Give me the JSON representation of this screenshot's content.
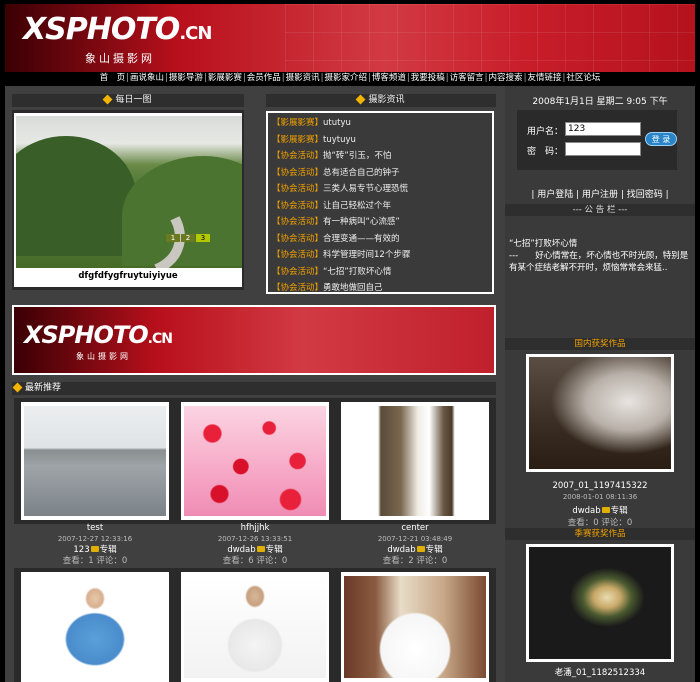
{
  "site": {
    "logo_main": "XSPHOTO",
    "logo_tld": ".CN",
    "logo_sub": "象山摄影网"
  },
  "nav": {
    "items": [
      "首　页",
      "画说象山",
      "摄影导游",
      "影展影赛",
      "会员作品",
      "摄影资讯",
      "摄影家介绍",
      "博客频道",
      "我要投稿",
      "访客留言",
      "内容搜索",
      "友情链接",
      "社区论坛"
    ]
  },
  "daily": {
    "title": "每日一图",
    "caption": "dfgfdfygfruytuiyiyue",
    "pager": [
      "1",
      "2",
      "3"
    ]
  },
  "news": {
    "title": "摄影资讯",
    "items": [
      {
        "tag": "【影展影赛】",
        "text": "ututyu"
      },
      {
        "tag": "【影展影赛】",
        "text": "tuytuyu"
      },
      {
        "tag": "【协会活动】",
        "text": "抛“砖”引玉，不怕"
      },
      {
        "tag": "【协会活动】",
        "text": "总有适合自己的钟子"
      },
      {
        "tag": "【协会活动】",
        "text": "三类人易专节心理恐慌"
      },
      {
        "tag": "【协会活动】",
        "text": "让自己轻松过个年"
      },
      {
        "tag": "【协会活动】",
        "text": "有一种病叫“心流感”"
      },
      {
        "tag": "【协会活动】",
        "text": "合理变通——有效的"
      },
      {
        "tag": "【协会活动】",
        "text": "科学管理时间12个步骤"
      },
      {
        "tag": "【协会活动】",
        "text": "“七招”打败坏心情"
      },
      {
        "tag": "【协会活动】",
        "text": "勇敢地做回自己"
      }
    ]
  },
  "login": {
    "date": "2008年1月1日 星期二 9:05 下午",
    "username_label": "用户名：",
    "username_value": "123",
    "password_label": "密　码：",
    "submit_label": "登 录",
    "links": "| 用户登陆 | 用户注册 | 找回密码 |"
  },
  "notice": {
    "title": "--- 公 告 栏 ---",
    "heading": "“七招”打败坏心情",
    "body": "---　　好心情常在，坏心情也不时光顾，特别是有某个症结老解不开时，烦恼常常会来猛.."
  },
  "awards": [
    {
      "title": "国内获奖作品",
      "caption": "2007_01_1197415322",
      "date": "2008-01-01 08:11:36",
      "author": "dwdab",
      "album": "专辑",
      "stats": "查看：0 评论：0"
    },
    {
      "title": "季赛获奖作品",
      "caption": "老潘_01_1182512334",
      "date": "",
      "author": "",
      "album": "",
      "stats": ""
    }
  ],
  "banner2": {
    "logo_main": "XSPHOTO",
    "logo_tld": ".CN",
    "logo_sub": "象山摄影网"
  },
  "recommend": {
    "title": "最新推荐",
    "items": [
      {
        "title": "test",
        "date": "2007-12-27 12:33:16",
        "author": "123",
        "album": "专辑",
        "stats": "查看：1 评论：0"
      },
      {
        "title": "hfhjjhk",
        "date": "2007-12-26 13:33:51",
        "author": "dwdab",
        "album": "专辑",
        "stats": "查看：6 评论：0"
      },
      {
        "title": "center",
        "date": "2007-12-21 03:48:49",
        "author": "dwdab",
        "album": "专辑",
        "stats": "查看：2 评论：0"
      }
    ]
  },
  "colors": {
    "accent_orange": "#f0a000",
    "brand_red": "#c81e2a",
    "panel_gray": "#404040"
  }
}
